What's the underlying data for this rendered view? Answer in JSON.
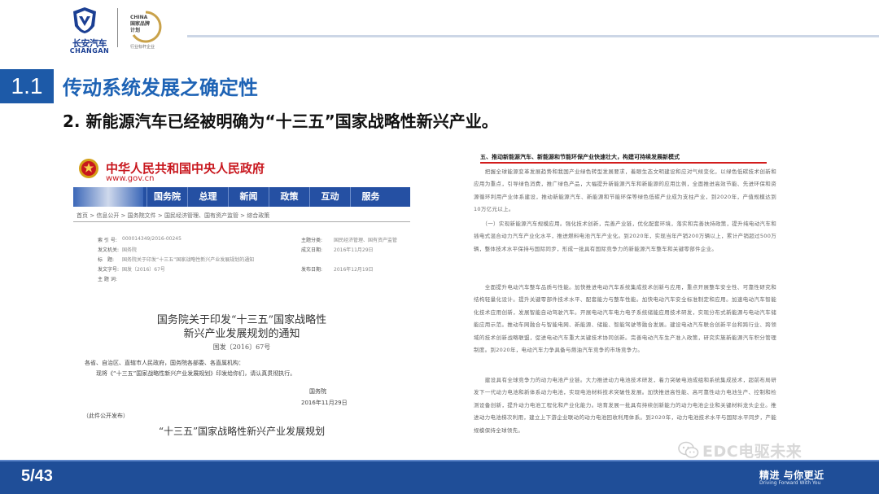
{
  "header": {
    "logo_cn": "长安汽车",
    "logo_en": "CHANGAN",
    "badge_lines": [
      "CHINA",
      "国家品牌",
      "计划"
    ],
    "badge_sub": "行业标杆企业"
  },
  "section": {
    "number": "1.1",
    "title": "传动系统发展之确定性"
  },
  "subtitle": "2. 新能源汽车已经被明确为“十三五”国家战略性新兴产业。",
  "left_doc": {
    "gov_title": "中华人民共和国中央人民政府",
    "gov_url": "www.gov.cn",
    "nav": [
      "国务院",
      "总理",
      "新闻",
      "政策",
      "互动",
      "服务"
    ],
    "breadcrumb": "首页 > 信息公开 > 国务院文件 > 国民经济管理、国有资产监管 > 综合政策",
    "meta": [
      {
        "k": "索 引 号:",
        "v": "000014349/2016-00245",
        "k2": "主题分类:",
        "v2": "国民经济管理、国有资产监管"
      },
      {
        "k": "发文机关:",
        "v": "国务院",
        "k2": "成文日期:",
        "v2": "2016年11月29日"
      },
      {
        "k": "标　题:",
        "v": "国务院关于印发“十三五”国家战略性新兴产业发展规划的通知",
        "k2": "",
        "v2": ""
      },
      {
        "k": "发文字号:",
        "v": "国发〔2016〕67号",
        "k2": "发布日期:",
        "v2": "2016年12月19日"
      },
      {
        "k": "主 题 词:",
        "v": "",
        "k2": "",
        "v2": ""
      }
    ],
    "notice_title_1": "国务院关于印发“十三五”国家战略性",
    "notice_title_2": "新兴产业发展规划的通知",
    "notice_no": "国发〔2016〕67号",
    "notice_body_1": "各省、自治区、直辖市人民政府，国务院各部委、各直属机构：",
    "notice_body_2": "　　现将《“十三五”国家战略性新兴产业发展规划》印发给你们，请认真贯彻执行。",
    "notice_sign": "国务院",
    "notice_date": "2016年11月29日",
    "notice_public": "（此件公开发布）",
    "plan_title": "“十三五”国家战略性新兴产业发展规划"
  },
  "right_doc": {
    "heading": "五、推动新能源汽车、新能源和节能环保产业快速壮大，构建可持续发展新模式",
    "paragraphs": [
      "　　把握全球能源变革发展趋势和我国产业绿色转型发展要求，着眼生态文明建设和应对气候变化，以绿色低碳技术创新和应用为重点，引导绿色消费，推广绿色产品，大幅提升新能源汽车和新能源的应用比例，全面推进高效节能、先进环保和资源循环利用产业体系建设，推动新能源汽车、新能源和节能环保等绿色低碳产业成为支柱产业，到2020年，产值规模达到10万亿元以上。",
      "　　（一）实现新能源汽车规模应用。强化技术创新，完善产业链，优化配套环境，落实和完善扶持政策，提升纯电动汽车和插电式混合动力汽车产业化水平，推进燃料电池汽车产业化。到2020年，实现当年产销200万辆以上，累计产销超过500万辆，整体技术水平保持与国际同步，形成一批具有国际竞争力的新能源汽车整车和关键零部件企业。",
      "　　全面提升电动汽车整车品质与性能。加快推进电动汽车系统集成技术创新与应用，重点开展整车安全性、可靠性研究和结构轻量化设计。提升关键零部件技术水平、配套能力与整车性能。加快电动汽车安全标准制定和应用。加速电动汽车智能化技术应用创新，发展智能自动驾驶汽车。开展电动汽车电力电子系统储能应用技术研发，实现分布式新能源与电动汽车储能应用示范。推动车网融合与智能电网、新能源、储能、智能驾驶等融合发展。建设电动汽车联合创新平台和跨行业、跨领域的技术创新战略联盟，促进电动汽车重大关键技术协同创新。完善电动汽车生产准入政策，研究实施新能源汽车积分管理制度。到2020年，电动汽车力争具备与燃油汽车竞争的市场竞争力。",
      "　　建设具有全球竞争力的动力电池产业链。大力推进动力电池技术研发，着力突破电池成组和系统集成技术，超前布局研发下一代动力电池和新体系动力电池，实现电池材料技术突破性发展。加快推进高性能、高可靠性动力电池生产、控制和检测设备创新，提升动力电池工程化和产业化能力。培育发展一批具有持续创新能力的动力电池企业和关键材料龙头企业。推进动力电池梯次利用，建立上下游企业联动的动力电池回收利用体系。到2020年，动力电池技术水平与国际水平同步，产能规模保持全球领先。"
    ]
  },
  "footer": {
    "page": "5/43",
    "slogan": "精进 与你更近",
    "slogan_en": "Driving Forward With You"
  },
  "watermark": {
    "text": "EDC电驱未来",
    "icon": "wechat-icon"
  },
  "colors": {
    "brand_blue": "#1d5aa8",
    "title_blue": "#1e63b5",
    "footer_blue": "#1f4e98",
    "gov_red": "#c8161d",
    "underline_red": "#d21c1c"
  }
}
